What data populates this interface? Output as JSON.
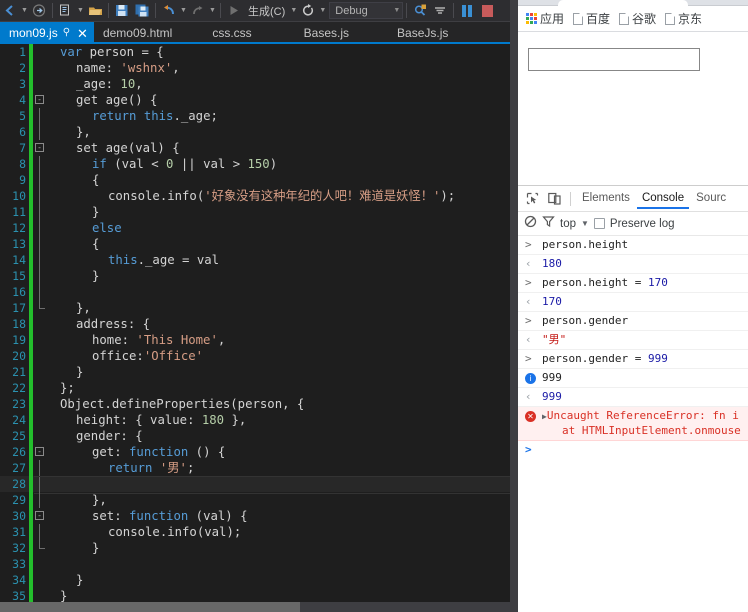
{
  "vs": {
    "toolbar": {
      "build_label": "生成(C)",
      "config_label": "Debug",
      "icons": [
        "navigate-back-icon",
        "navigate-forward-icon",
        "new-item-icon",
        "open-file-icon",
        "save-icon",
        "save-all-icon",
        "undo-icon",
        "redo-icon",
        "start-debug-icon",
        "refresh-icon",
        "find-icon",
        "outline-icon",
        "pause-icon",
        "stop-icon"
      ]
    },
    "tabs": [
      {
        "label": "mon09.js",
        "active": true,
        "pin": "⚲",
        "close": "✕"
      },
      {
        "label": "demo09.html",
        "active": false
      },
      {
        "label": "css.css",
        "active": false
      },
      {
        "label": "Bases.js",
        "active": false
      },
      {
        "label": "BaseJs.js",
        "active": false
      }
    ],
    "code": {
      "current_line": 28,
      "lines": [
        {
          "n": 1,
          "indent": 1,
          "fold": "",
          "guide": "",
          "tokens": [
            [
              "kw",
              "var"
            ],
            [
              "idt",
              " person = "
            ],
            [
              "pun",
              "{"
            ]
          ]
        },
        {
          "n": 2,
          "indent": 2,
          "fold": "",
          "guide": "",
          "tokens": [
            [
              "idt",
              "name: "
            ],
            [
              "str",
              "'wshnx'"
            ],
            [
              "pun",
              ","
            ]
          ]
        },
        {
          "n": 3,
          "indent": 2,
          "fold": "",
          "guide": "",
          "tokens": [
            [
              "idt",
              "_age: "
            ],
            [
              "num",
              "10"
            ],
            [
              "pun",
              ","
            ]
          ]
        },
        {
          "n": 4,
          "indent": 2,
          "fold": "-",
          "guide": "",
          "tokens": [
            [
              "idt",
              "get age() "
            ],
            [
              "pun",
              "{"
            ]
          ]
        },
        {
          "n": 5,
          "indent": 3,
          "fold": "",
          "guide": "line",
          "tokens": [
            [
              "kw",
              "return"
            ],
            [
              "kw",
              " this"
            ],
            [
              "idt",
              "._age"
            ],
            [
              "pun",
              ";"
            ]
          ]
        },
        {
          "n": 6,
          "indent": 2,
          "fold": "",
          "guide": "line",
          "tokens": [
            [
              "pun",
              "},"
            ]
          ]
        },
        {
          "n": 7,
          "indent": 2,
          "fold": "-",
          "guide": "end",
          "tokens": [
            [
              "idt",
              "set age(val) "
            ],
            [
              "pun",
              "{"
            ]
          ]
        },
        {
          "n": 8,
          "indent": 3,
          "fold": "",
          "guide": "line",
          "tokens": [
            [
              "kw",
              "if"
            ],
            [
              "idt",
              " (val "
            ],
            [
              "pun",
              "<"
            ],
            [
              "num",
              " 0"
            ],
            [
              "idt",
              " || val "
            ],
            [
              "pun",
              ">"
            ],
            [
              "num",
              " 150"
            ],
            [
              "idt",
              ")"
            ]
          ]
        },
        {
          "n": 9,
          "indent": 3,
          "fold": "",
          "guide": "line",
          "tokens": [
            [
              "pun",
              "{"
            ]
          ]
        },
        {
          "n": 10,
          "indent": 4,
          "fold": "",
          "guide": "line",
          "tokens": [
            [
              "idt",
              "console.info("
            ],
            [
              "str",
              "'好象没有这种年纪的人吧！难道是妖怪！'"
            ],
            [
              "pun",
              ");"
            ]
          ]
        },
        {
          "n": 11,
          "indent": 3,
          "fold": "",
          "guide": "line",
          "tokens": [
            [
              "pun",
              "}"
            ]
          ]
        },
        {
          "n": 12,
          "indent": 3,
          "fold": "",
          "guide": "line",
          "tokens": [
            [
              "kw",
              "else"
            ]
          ]
        },
        {
          "n": 13,
          "indent": 3,
          "fold": "",
          "guide": "line",
          "tokens": [
            [
              "pun",
              "{"
            ]
          ]
        },
        {
          "n": 14,
          "indent": 4,
          "fold": "",
          "guide": "line",
          "tokens": [
            [
              "kw",
              "this"
            ],
            [
              "idt",
              "._age = val"
            ]
          ]
        },
        {
          "n": 15,
          "indent": 3,
          "fold": "",
          "guide": "line",
          "tokens": [
            [
              "pun",
              "}"
            ]
          ]
        },
        {
          "n": 16,
          "indent": 0,
          "fold": "",
          "guide": "line",
          "tokens": []
        },
        {
          "n": 17,
          "indent": 2,
          "fold": "",
          "guide": "end",
          "tokens": [
            [
              "pun",
              "},"
            ]
          ]
        },
        {
          "n": 18,
          "indent": 2,
          "fold": "",
          "guide": "",
          "tokens": [
            [
              "idt",
              "address: "
            ],
            [
              "pun",
              "{"
            ]
          ]
        },
        {
          "n": 19,
          "indent": 3,
          "fold": "",
          "guide": "",
          "tokens": [
            [
              "idt",
              "home: "
            ],
            [
              "str",
              "'This Home'"
            ],
            [
              "pun",
              ","
            ]
          ]
        },
        {
          "n": 20,
          "indent": 3,
          "fold": "",
          "guide": "",
          "tokens": [
            [
              "idt",
              "office:"
            ],
            [
              "str",
              "'Office'"
            ]
          ]
        },
        {
          "n": 21,
          "indent": 2,
          "fold": "",
          "guide": "",
          "tokens": [
            [
              "pun",
              "}"
            ]
          ]
        },
        {
          "n": 22,
          "indent": 1,
          "fold": "",
          "guide": "",
          "tokens": [
            [
              "pun",
              "};"
            ]
          ]
        },
        {
          "n": 23,
          "indent": 1,
          "fold": "",
          "guide": "",
          "tokens": [
            [
              "idt",
              "Object.defineProperties(person, "
            ],
            [
              "pun",
              "{"
            ]
          ]
        },
        {
          "n": 24,
          "indent": 2,
          "fold": "",
          "guide": "",
          "tokens": [
            [
              "idt",
              "height: "
            ],
            [
              "pun",
              "{ "
            ],
            [
              "idt",
              "value: "
            ],
            [
              "num",
              "180"
            ],
            [
              "pun",
              " },"
            ]
          ]
        },
        {
          "n": 25,
          "indent": 2,
          "fold": "",
          "guide": "",
          "tokens": [
            [
              "idt",
              "gender: "
            ],
            [
              "pun",
              "{"
            ]
          ]
        },
        {
          "n": 26,
          "indent": 3,
          "fold": "-",
          "guide": "",
          "tokens": [
            [
              "idt",
              "get: "
            ],
            [
              "kw",
              "function"
            ],
            [
              "idt",
              " () "
            ],
            [
              "pun",
              "{"
            ]
          ]
        },
        {
          "n": 27,
          "indent": 4,
          "fold": "",
          "guide": "line",
          "tokens": [
            [
              "kw",
              "return"
            ],
            [
              "str",
              " '男'"
            ],
            [
              "pun",
              ";"
            ]
          ]
        },
        {
          "n": 28,
          "indent": 0,
          "fold": "",
          "guide": "line",
          "tokens": []
        },
        {
          "n": 29,
          "indent": 3,
          "fold": "",
          "guide": "line",
          "tokens": [
            [
              "pun",
              "},"
            ]
          ]
        },
        {
          "n": 30,
          "indent": 3,
          "fold": "-",
          "guide": "end",
          "tokens": [
            [
              "idt",
              "set: "
            ],
            [
              "kw",
              "function"
            ],
            [
              "idt",
              " (val) "
            ],
            [
              "pun",
              "{"
            ]
          ]
        },
        {
          "n": 31,
          "indent": 4,
          "fold": "",
          "guide": "line",
          "tokens": [
            [
              "idt",
              "console.info(val)"
            ],
            [
              "pun",
              ";"
            ]
          ]
        },
        {
          "n": 32,
          "indent": 3,
          "fold": "",
          "guide": "end",
          "tokens": [
            [
              "pun",
              "}"
            ]
          ]
        },
        {
          "n": 33,
          "indent": 0,
          "fold": "",
          "guide": "",
          "tokens": []
        },
        {
          "n": 34,
          "indent": 2,
          "fold": "",
          "guide": "",
          "tokens": [
            [
              "pun",
              "}"
            ]
          ]
        },
        {
          "n": 35,
          "indent": 1,
          "fold": "",
          "guide": "",
          "tokens": [
            [
              "pun",
              "}"
            ]
          ]
        }
      ]
    }
  },
  "chrome": {
    "bookmarks": [
      {
        "label": "应用",
        "icon": "apps-grid-icon"
      },
      {
        "label": "百度",
        "icon": "page-icon"
      },
      {
        "label": "谷歌",
        "icon": "page-icon"
      },
      {
        "label": "京东",
        "icon": "page-icon"
      }
    ],
    "page": {
      "input_value": "",
      "input_placeholder": ""
    }
  },
  "devtools": {
    "tabs": [
      {
        "label": "Elements",
        "active": false
      },
      {
        "label": "Console",
        "active": true
      },
      {
        "label": "Sourc",
        "active": false
      }
    ],
    "toolbar_icons": [
      "inspect-element-icon",
      "device-toolbar-icon"
    ],
    "filter": {
      "clear_label": "⊘",
      "context": "top",
      "caret": "▼",
      "preserve_log_label": "Preserve log",
      "preserve_log_checked": false
    },
    "console_messages": [
      {
        "kind": "input",
        "gutter": ">",
        "text": "person.height"
      },
      {
        "kind": "result",
        "gutter": "‹",
        "text": "180"
      },
      {
        "kind": "input",
        "gutter": ">",
        "text": "person.height = 170",
        "num_tail": "170"
      },
      {
        "kind": "result",
        "gutter": "‹",
        "text": "170"
      },
      {
        "kind": "input",
        "gutter": ">",
        "text": "person.gender"
      },
      {
        "kind": "result",
        "gutter": "‹",
        "text": "\"男\"",
        "string": true
      },
      {
        "kind": "input",
        "gutter": ">",
        "text": "person.gender = 999",
        "num_tail": "999"
      },
      {
        "kind": "info",
        "gutter": "i",
        "text": "999"
      },
      {
        "kind": "result",
        "gutter": "‹",
        "text": "999"
      },
      {
        "kind": "error",
        "gutter": "x",
        "text": "Uncaught ReferenceError: fn i",
        "line2": "at HTMLInputElement.onmouse",
        "expander": "▶"
      },
      {
        "kind": "prompt",
        "gutter": ">",
        "text": ""
      }
    ]
  }
}
